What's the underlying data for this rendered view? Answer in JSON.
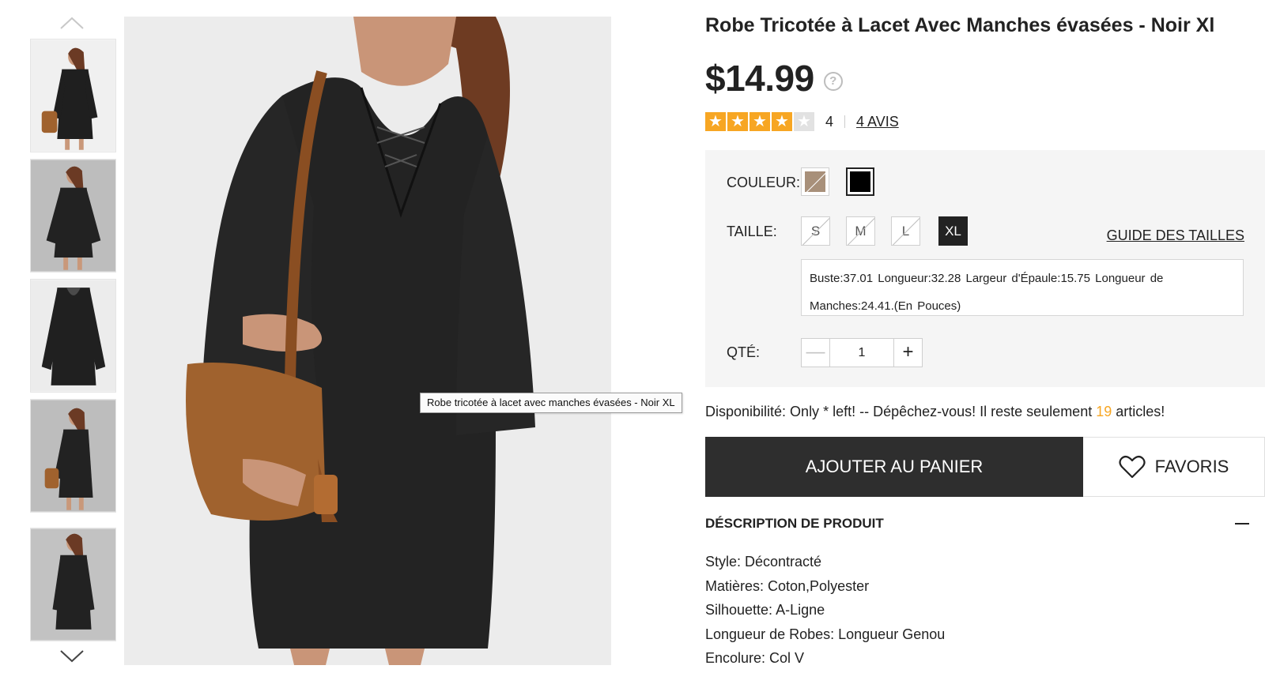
{
  "product": {
    "title": "Robe Tricotée à Lacet Avec Manches évasées - Noir Xl",
    "price": "$14.99",
    "help_icon": "?",
    "rating": {
      "value": 4,
      "max": 5,
      "count_label": "4",
      "reviews_label": "4 AVIS"
    },
    "image_tooltip": "Robe tricotée à lacet avec manches évasées - Noir XL"
  },
  "thumbnails": {
    "items": [
      {
        "name": "thumbnail-1"
      },
      {
        "name": "thumbnail-2"
      },
      {
        "name": "thumbnail-3"
      },
      {
        "name": "thumbnail-4"
      },
      {
        "name": "thumbnail-5"
      }
    ],
    "up_icon": "chevron-up-icon",
    "down_icon": "chevron-down-icon"
  },
  "options": {
    "color_label": "COULEUR:",
    "colors": [
      {
        "name": "brown",
        "hex": "#a8907a",
        "selected": false,
        "disabled": true
      },
      {
        "name": "black",
        "hex": "#000000",
        "selected": true,
        "disabled": false
      }
    ],
    "size_label": "TAILLE:",
    "sizes": [
      {
        "label": "S",
        "disabled": true,
        "selected": false
      },
      {
        "label": "M",
        "disabled": true,
        "selected": false
      },
      {
        "label": "L",
        "disabled": true,
        "selected": false
      },
      {
        "label": "XL",
        "disabled": false,
        "selected": true
      }
    ],
    "size_guide": "GUIDE DES TAILLES",
    "measurements": "Buste:37.01   Longueur:32.28   Largeur d'Épaule:15.75   Longueur de Manches:24.41.(En Pouces)",
    "qty_label": "QTÉ:",
    "qty_minus": "—",
    "qty_value": "1",
    "qty_plus": "+"
  },
  "availability": {
    "prefix": "Disponibilité: Only * left! -- Dépêchez-vous! Il reste seulement ",
    "count": "19",
    "suffix": " articles!"
  },
  "actions": {
    "add_to_cart": "AJOUTER AU PANIER",
    "favorites": "FAVORIS",
    "favorites_icon": "heart-icon"
  },
  "description": {
    "title": "DÉSCRIPTION DE PRODUIT",
    "items": [
      "Style: Décontracté",
      "Matières: Coton,Polyester",
      "Silhouette: A-Ligne",
      "Longueur de Robes: Longueur Genou",
      "Encolure: Col V"
    ]
  },
  "colors": {
    "accent": "#f7a623",
    "dark_button": "#2e2e2e",
    "panel_bg": "#f5f5f5"
  }
}
